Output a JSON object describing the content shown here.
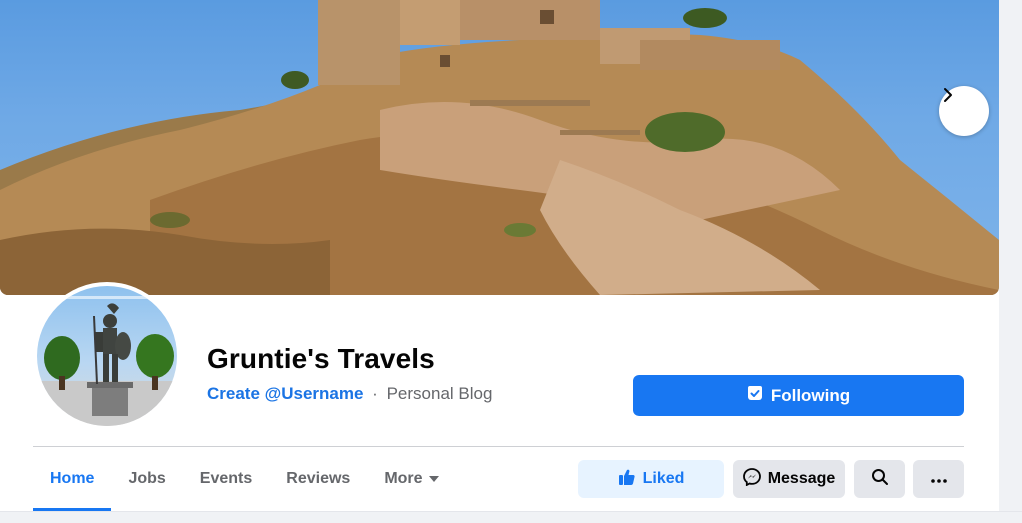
{
  "colors": {
    "accent": "#1877f2",
    "link": "#1b74e4",
    "secondary_text": "#65676b",
    "button_gray": "#e4e6eb",
    "liked_bg": "#e7f3ff"
  },
  "cover": {
    "image": "castle-on-rocky-hill-photo",
    "next_icon": "chevron-right-icon"
  },
  "profile": {
    "avatar_image": "warrior-statue-photo",
    "name": "Gruntie's Travels",
    "username_link": "Create @Username",
    "separator": "·",
    "category": "Personal Blog"
  },
  "primary_action": {
    "label": "Following",
    "icon": "following-check-icon"
  },
  "tabs": [
    {
      "label": "Home",
      "active": true
    },
    {
      "label": "Jobs",
      "active": false
    },
    {
      "label": "Events",
      "active": false
    },
    {
      "label": "Reviews",
      "active": false
    },
    {
      "label": "More",
      "active": false
    }
  ],
  "actions": {
    "liked": {
      "label": "Liked",
      "icon": "thumbs-up-icon"
    },
    "message": {
      "label": "Message",
      "icon": "messenger-icon"
    },
    "search": {
      "icon": "search-icon"
    },
    "more": {
      "icon": "ellipsis-icon"
    }
  }
}
